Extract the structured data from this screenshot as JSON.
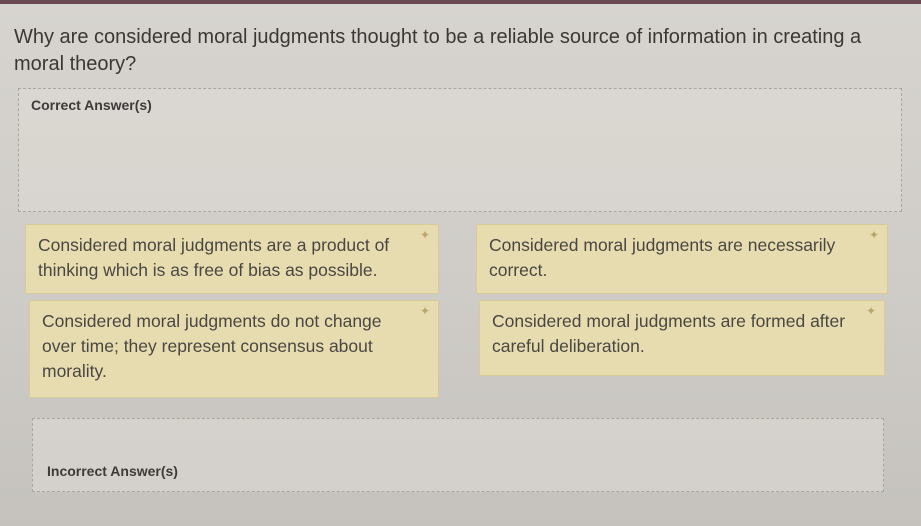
{
  "question": {
    "text": "Why are considered moral judgments thought to be a reliable source of information in creating a moral theory?"
  },
  "zones": {
    "correct_label": "Correct Answer(s)",
    "incorrect_label": "Incorrect Answer(s)"
  },
  "cards": [
    {
      "text": "Considered moral judgments are a product of thinking which is as free of bias as possible.",
      "handle_icon": "move-handle-icon"
    },
    {
      "text": "Considered moral judgments are necessarily correct.",
      "handle_icon": "move-handle-icon"
    },
    {
      "text": "Considered moral judgments do not change over time; they represent consensus about morality.",
      "handle_icon": "move-handle-icon"
    },
    {
      "text": "Considered moral judgments are formed after careful deliberation.",
      "handle_icon": "move-handle-icon"
    }
  ],
  "colors": {
    "card_background": "#e7dcb0",
    "page_background": "#d7d4cf",
    "top_strip": "#6b4a55"
  }
}
